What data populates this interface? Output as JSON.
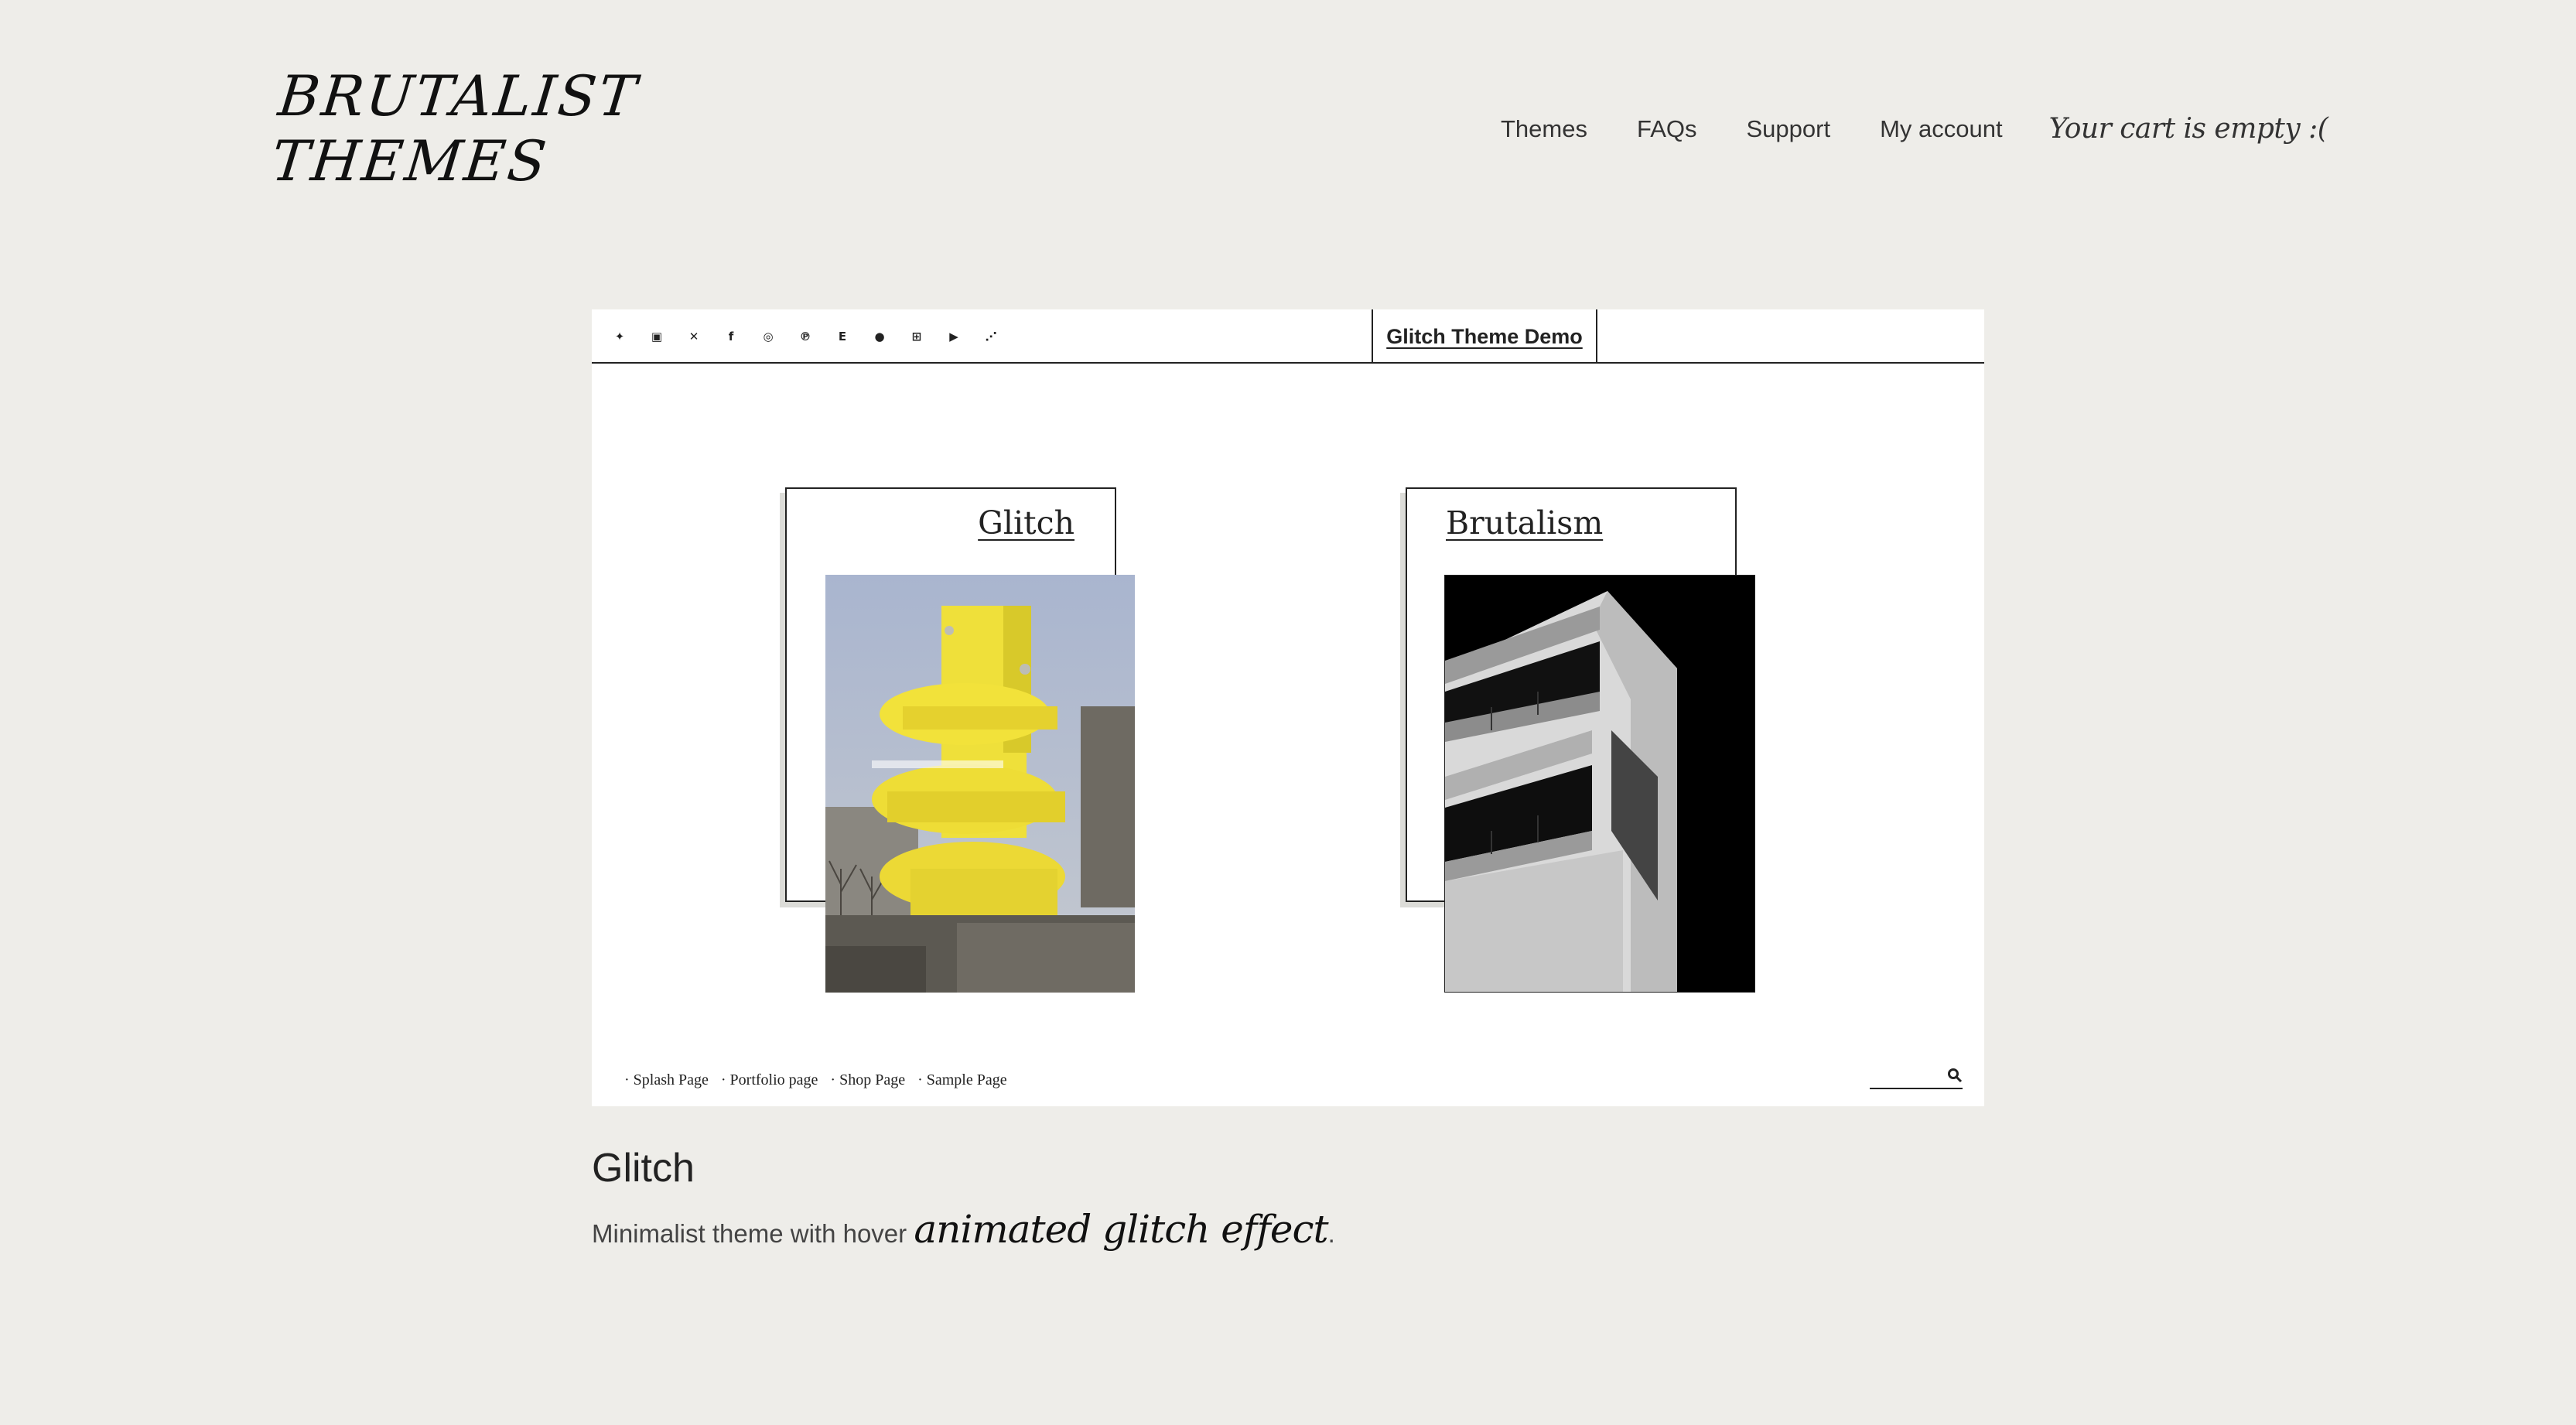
{
  "header": {
    "logo_line1": "BRUTALIST",
    "logo_line2": "THEMES",
    "nav": [
      "Themes",
      "FAQs",
      "Support",
      "My account"
    ],
    "cart_text": "Your cart is empty :("
  },
  "demo": {
    "title": "Glitch Theme Demo",
    "socials": [
      {
        "icon": "twitter-icon",
        "glyph": "✦"
      },
      {
        "icon": "linkedin-icon",
        "glyph": "▣"
      },
      {
        "icon": "xing-icon",
        "glyph": "✕"
      },
      {
        "icon": "facebook-icon",
        "glyph": "f"
      },
      {
        "icon": "instagram-icon",
        "glyph": "◎"
      },
      {
        "icon": "pinterest-icon",
        "glyph": "℗"
      },
      {
        "icon": "etsy-icon",
        "glyph": "E"
      },
      {
        "icon": "goodreads-icon",
        "glyph": "●"
      },
      {
        "icon": "flickr-icon",
        "glyph": "⊞"
      },
      {
        "icon": "youtube-icon",
        "glyph": "▶"
      },
      {
        "icon": "rss-icon",
        "glyph": "⋰"
      }
    ],
    "cards": [
      {
        "label": "Glitch"
      },
      {
        "label": "Brutalism"
      }
    ],
    "footer_links": [
      "· Splash Page",
      "· Portfolio page",
      "· Shop Page",
      "· Sample Page"
    ],
    "search_placeholder": ""
  },
  "caption": {
    "title": "Glitch",
    "desc_prefix": "Minimalist theme with hover ",
    "desc_highlight": "animated glitch effect",
    "desc_suffix": "."
  },
  "colors": {
    "background": "#eeede9",
    "frame": "#ffffff",
    "accent_yellow": "#f2e23a",
    "ink": "#222222"
  }
}
